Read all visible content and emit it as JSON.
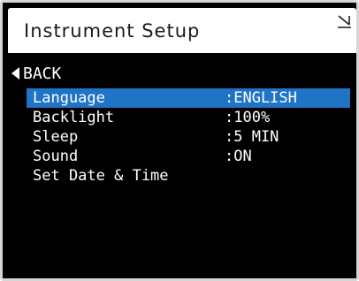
{
  "header": {
    "title": "Instrument Setup",
    "corner_icon": "signal-icon"
  },
  "nav": {
    "back_label": "BACK",
    "back_icon": "triangle-left-icon"
  },
  "colors": {
    "header_bg": "#ffffff",
    "screen_bg": "#000000",
    "selection": "#1f74c6",
    "text": "#ffffff"
  },
  "menu": {
    "items": [
      {
        "label": "Language",
        "value": ":ENGLISH",
        "selected": true
      },
      {
        "label": "Backlight",
        "value": ":100%",
        "selected": false
      },
      {
        "label": "Sleep",
        "value": ":5 MIN",
        "selected": false
      },
      {
        "label": "Sound",
        "value": ":ON",
        "selected": false
      },
      {
        "label": "Set Date & Time",
        "value": "",
        "selected": false
      }
    ]
  }
}
